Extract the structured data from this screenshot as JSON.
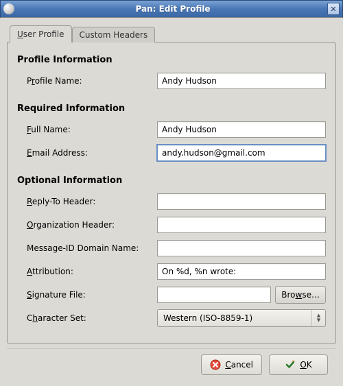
{
  "window": {
    "title": "Pan: Edit Profile"
  },
  "tabs": {
    "user_profile": "User Profile",
    "custom_headers": "Custom Headers"
  },
  "sections": {
    "profile_info": "Profile Information",
    "required_info": "Required Information",
    "optional_info": "Optional Information"
  },
  "labels": {
    "profile_name_pre": "P",
    "profile_name_ul": "r",
    "profile_name_post": "ofile Name:",
    "full_name_ul": "F",
    "full_name_post": "ull Name:",
    "email_ul": "E",
    "email_post": "mail Address:",
    "reply_ul": "R",
    "reply_post": "eply-To Header:",
    "org_ul": "O",
    "org_post": "rganization Header:",
    "msgid": "Message-ID Domain Name:",
    "attr_ul": "A",
    "attr_post": "ttribution:",
    "sig_ul": "S",
    "sig_post": "ignature File:",
    "charset_pre": "C",
    "charset_ul": "h",
    "charset_post": "aracter Set:",
    "browse_pre": "Bro",
    "browse_ul": "w",
    "browse_post": "se…",
    "cancel_ul": "C",
    "cancel_post": "ancel",
    "ok_ul": "O",
    "ok_post": "K"
  },
  "values": {
    "profile_name": "Andy Hudson",
    "full_name": "Andy Hudson",
    "email": "andy.hudson@gmail.com",
    "reply_to": "",
    "organization": "",
    "msgid_domain": "",
    "attribution": "On %d, %n wrote:",
    "signature_file": "",
    "charset": "Western (ISO-8859-1)"
  }
}
